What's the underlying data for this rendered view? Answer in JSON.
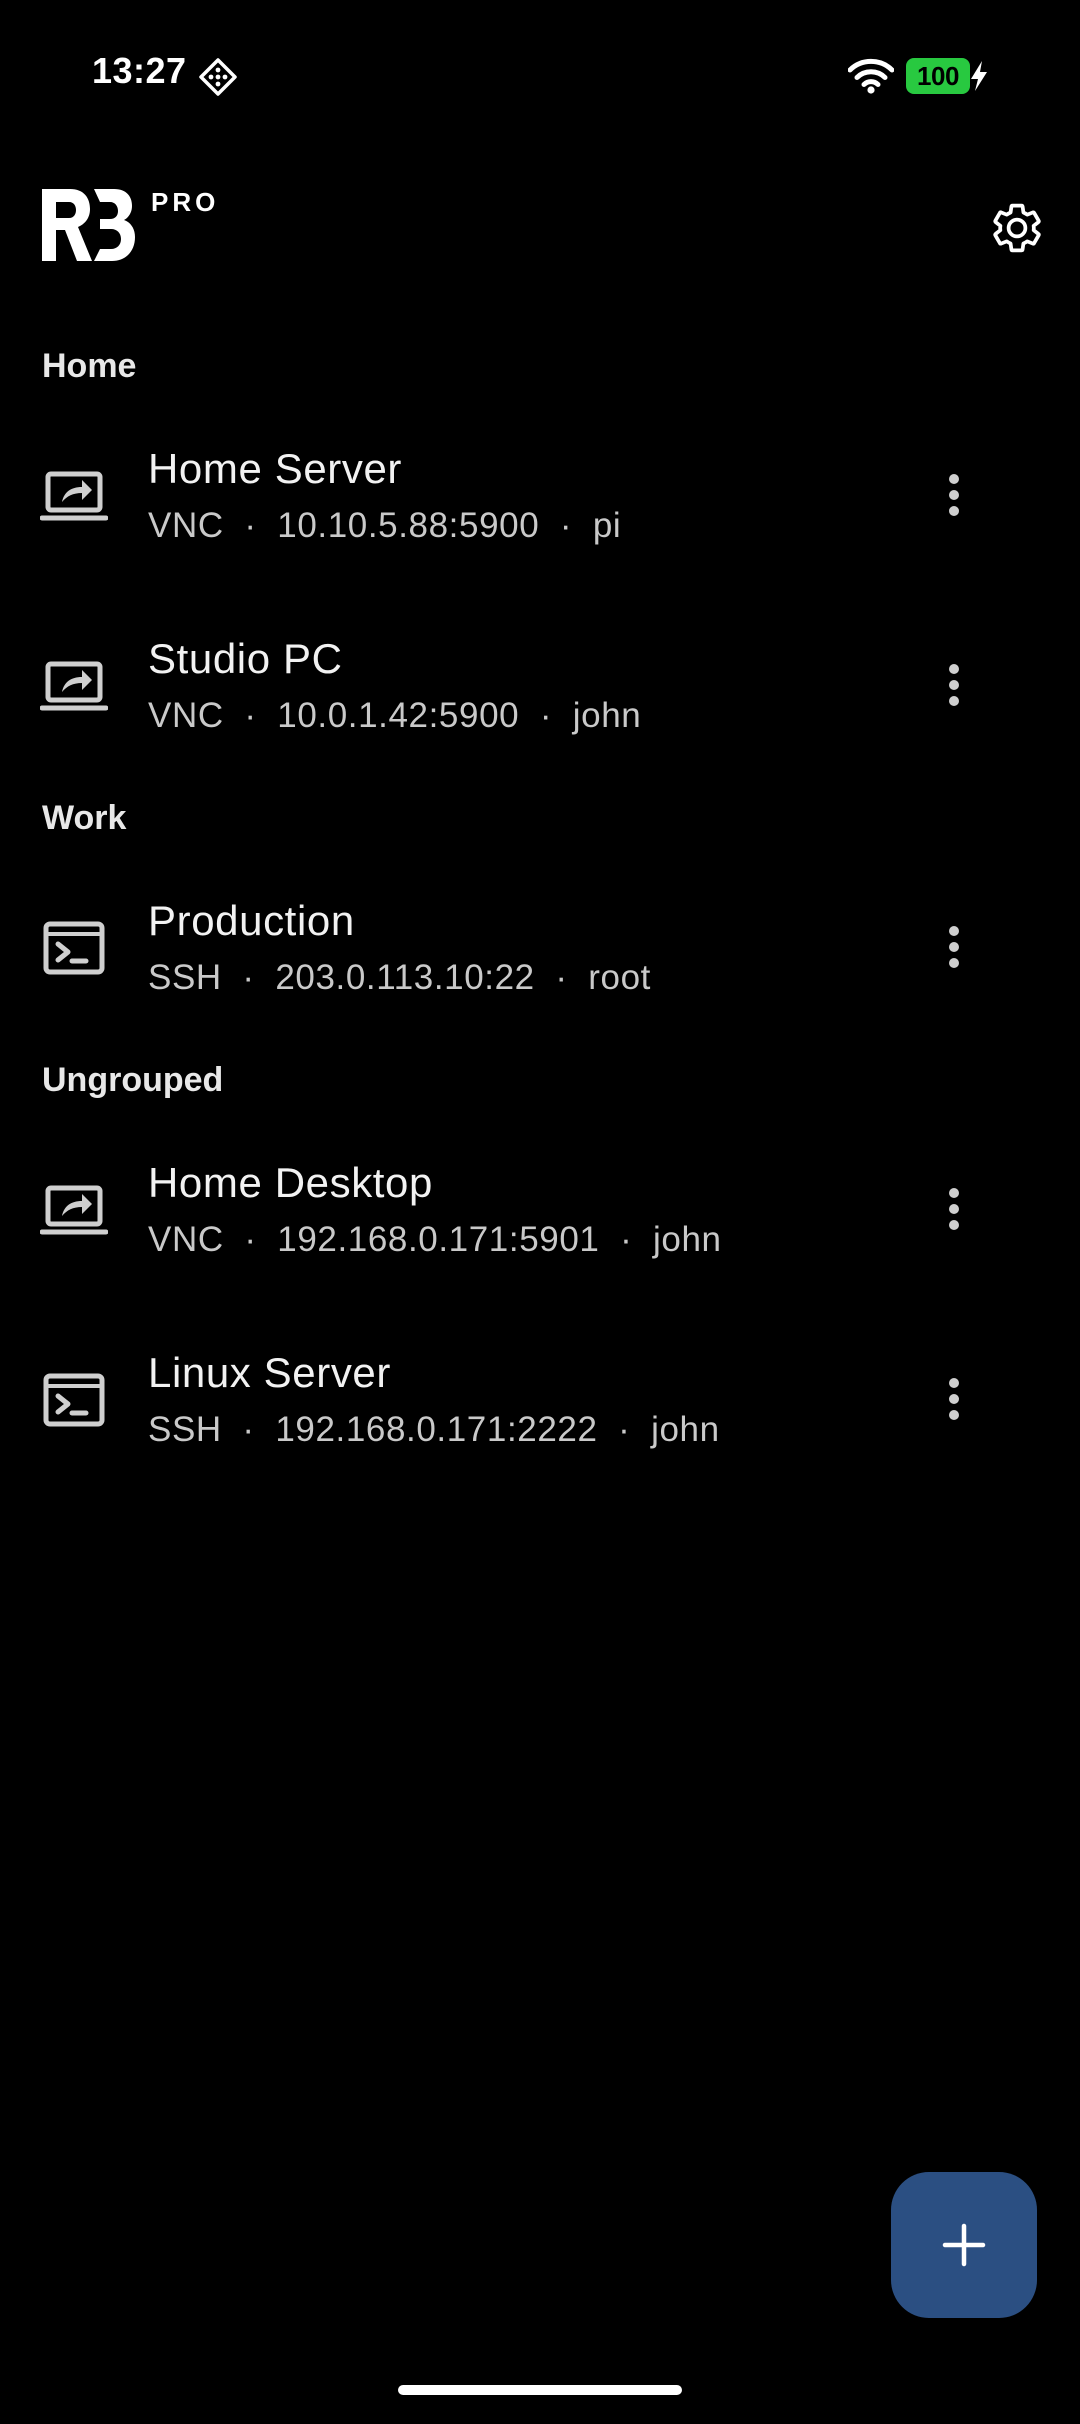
{
  "status_bar": {
    "time": "13:27",
    "shortcut_icon": "automation-diamond-icon",
    "wifi_icon": "wifi-icon",
    "battery_level": "100",
    "battery_color": "#28c940",
    "charging_icon": "bolt-icon"
  },
  "header": {
    "logo_icon": "rb-logo",
    "badge": "PRO",
    "settings_icon": "gear-icon"
  },
  "groups": [
    {
      "name": "Home",
      "connections": [
        {
          "title": "Home Server",
          "subtitle": "VNC  ·  10.10.5.88:5900  ·  pi",
          "protocol": "VNC",
          "icon": "laptop-share-icon"
        },
        {
          "title": "Studio PC",
          "subtitle": "VNC  ·  10.0.1.42:5900  ·  john",
          "protocol": "VNC",
          "icon": "laptop-share-icon"
        }
      ]
    },
    {
      "name": "Work",
      "connections": [
        {
          "title": "Production",
          "subtitle": "SSH  ·  203.0.113.10:22  ·  root",
          "protocol": "SSH",
          "icon": "terminal-icon"
        }
      ]
    },
    {
      "name": "Ungrouped",
      "connections": [
        {
          "title": "Home Desktop",
          "subtitle": "VNC  ·  192.168.0.171:5901  ·  john",
          "protocol": "VNC",
          "icon": "laptop-share-icon"
        },
        {
          "title": "Linux Server",
          "subtitle": "SSH  ·  192.168.0.171:2222  ·  john",
          "protocol": "SSH",
          "icon": "terminal-icon"
        }
      ]
    }
  ],
  "fab": {
    "icon": "plus-icon",
    "color": "#2b4f82"
  },
  "colors": {
    "background": "#000000",
    "text_primary": "#f2f2f2",
    "text_secondary": "#c9c9c9",
    "icon": "#cfcfcf"
  }
}
